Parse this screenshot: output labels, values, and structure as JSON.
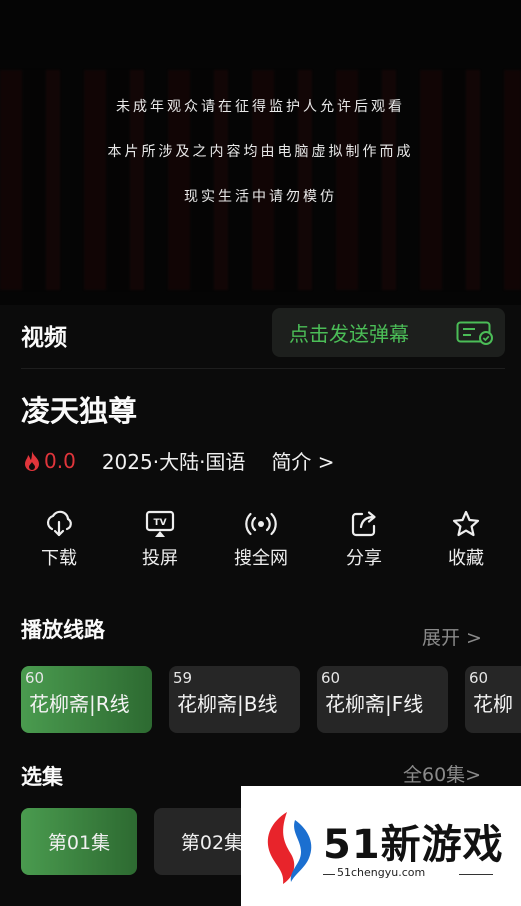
{
  "player": {
    "notice_lines": [
      "未成年观众请在征得监护人允许后观看",
      "本片所涉及之内容均由电脑虚拟制作而成",
      "现实生活中请勿模仿"
    ]
  },
  "video_section": {
    "heading": "视频",
    "danmaku_label": "点击发送弹幕"
  },
  "show": {
    "title": "凌天独尊",
    "heat": "0.0",
    "year_region_lang": "2025·大陆·国语",
    "intro_label": "简介 >"
  },
  "actions": [
    {
      "label": "下载",
      "icon": "download-icon"
    },
    {
      "label": "投屏",
      "icon": "cast-tv-icon"
    },
    {
      "label": "搜全网",
      "icon": "broadcast-icon"
    },
    {
      "label": "分享",
      "icon": "share-icon"
    },
    {
      "label": "收藏",
      "icon": "star-icon"
    }
  ],
  "routes": {
    "heading": "播放线路",
    "expand_label": "展开 >",
    "items": [
      {
        "count": "60",
        "name": "花柳斋|R线",
        "active": true
      },
      {
        "count": "59",
        "name": "花柳斋|B线",
        "active": false
      },
      {
        "count": "60",
        "name": "花柳斋|F线",
        "active": false
      },
      {
        "count": "60",
        "name": "花柳",
        "active": false
      }
    ]
  },
  "episodes": {
    "heading": "选集",
    "all_label": "全60集>",
    "items": [
      "第01集",
      "第02集"
    ]
  },
  "watermark": {
    "brand": "51新游戏",
    "domain": "51chengyu.com"
  },
  "colors": {
    "accent_green": "#4bbd57",
    "heat_red": "#e0353b",
    "background": "#0b0b0b"
  }
}
